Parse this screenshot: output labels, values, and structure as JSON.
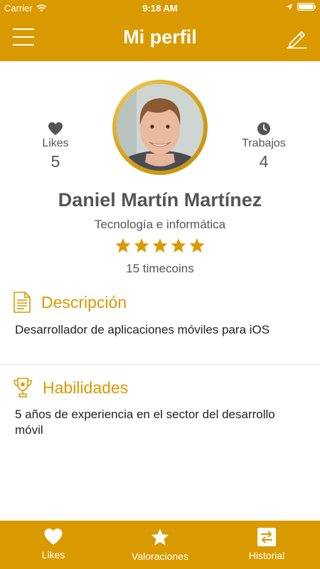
{
  "status_bar": {
    "carrier": "Carrier",
    "time": "9:18 AM"
  },
  "nav": {
    "title": "Mi perfil",
    "left_icon": "menu-icon",
    "right_icon": "edit-icon"
  },
  "profile": {
    "likes_label": "Likes",
    "likes_value": "5",
    "jobs_label": "Trabajos",
    "jobs_value": "4",
    "name": "Daniel Martín Martínez",
    "category": "Tecnología e informática",
    "rating": 5,
    "rating_max": 5,
    "timecoins": "15 timecoins"
  },
  "sections": [
    {
      "title": "Descripción",
      "icon": "document-icon",
      "text": "Desarrollador de aplicaciones móviles para iOS"
    },
    {
      "title": "Habilidades",
      "icon": "trophy-icon",
      "text": "5 años de experiencia en el sector del desarrollo móvil"
    }
  ],
  "tabs": [
    {
      "label": "Likes",
      "icon": "heart-icon"
    },
    {
      "label": "Valoraciones",
      "icon": "star-icon"
    },
    {
      "label": "Historial",
      "icon": "swap-icon"
    }
  ],
  "colors": {
    "accent": "#D99A00",
    "text": "#555555"
  }
}
